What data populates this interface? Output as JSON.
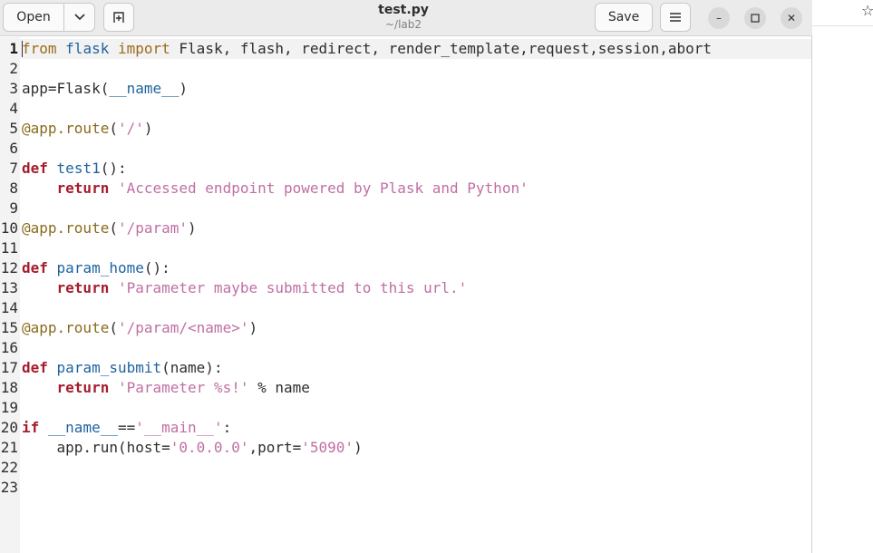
{
  "colors": {
    "keyword": "#a51d2d",
    "string": "#c06fa3",
    "function": "#1f63a0",
    "decorator": "#8a6a1a",
    "text": "#2e2e2e"
  },
  "toolbar": {
    "open_label": "Open",
    "open_arrow_icon": "chevron-down-icon",
    "new_tab_icon": "new-tab-icon",
    "save_label": "Save",
    "menu_icon": "hamburger-menu-icon"
  },
  "window": {
    "title": "test.py",
    "subtitle": "~/lab2",
    "minimize_glyph": "–",
    "maximize_glyph": "☐",
    "close_glyph": "✕"
  },
  "backdrop": {
    "star_glyph": "☆"
  },
  "editor": {
    "current_line": 1,
    "lines": [
      {
        "n": "1",
        "tokens": [
          {
            "t": "from",
            "c": "t-imp"
          },
          {
            "t": " ",
            "c": "t-plain"
          },
          {
            "t": "flask",
            "c": "t-mod"
          },
          {
            "t": " ",
            "c": "t-plain"
          },
          {
            "t": "import",
            "c": "t-imp"
          },
          {
            "t": " Flask, flash, redirect, render_template,request,session,abort",
            "c": "t-plain"
          }
        ]
      },
      {
        "n": "2",
        "tokens": []
      },
      {
        "n": "3",
        "tokens": [
          {
            "t": "app=Flask(",
            "c": "t-plain"
          },
          {
            "t": "__name__",
            "c": "t-dunder"
          },
          {
            "t": ")",
            "c": "t-plain"
          }
        ]
      },
      {
        "n": "4",
        "tokens": []
      },
      {
        "n": "5",
        "tokens": [
          {
            "t": "@app.route",
            "c": "t-deco"
          },
          {
            "t": "(",
            "c": "t-plain"
          },
          {
            "t": "'/'",
            "c": "t-str"
          },
          {
            "t": ")",
            "c": "t-plain"
          }
        ]
      },
      {
        "n": "6",
        "tokens": []
      },
      {
        "n": "7",
        "tokens": [
          {
            "t": "def",
            "c": "t-kw"
          },
          {
            "t": " ",
            "c": "t-plain"
          },
          {
            "t": "test1",
            "c": "t-fn"
          },
          {
            "t": "():",
            "c": "t-plain"
          }
        ]
      },
      {
        "n": "8",
        "tokens": [
          {
            "t": "    ",
            "c": "t-plain"
          },
          {
            "t": "return",
            "c": "t-kw"
          },
          {
            "t": " ",
            "c": "t-plain"
          },
          {
            "t": "'Accessed endpoint powered by Plask and Python'",
            "c": "t-str"
          }
        ]
      },
      {
        "n": "9",
        "tokens": []
      },
      {
        "n": "10",
        "tokens": [
          {
            "t": "@app.route",
            "c": "t-deco"
          },
          {
            "t": "(",
            "c": "t-plain"
          },
          {
            "t": "'/param'",
            "c": "t-str"
          },
          {
            "t": ")",
            "c": "t-plain"
          }
        ]
      },
      {
        "n": "11",
        "tokens": []
      },
      {
        "n": "12",
        "tokens": [
          {
            "t": "def",
            "c": "t-kw"
          },
          {
            "t": " ",
            "c": "t-plain"
          },
          {
            "t": "param_home",
            "c": "t-fn"
          },
          {
            "t": "():",
            "c": "t-plain"
          }
        ]
      },
      {
        "n": "13",
        "tokens": [
          {
            "t": "    ",
            "c": "t-plain"
          },
          {
            "t": "return",
            "c": "t-kw"
          },
          {
            "t": " ",
            "c": "t-plain"
          },
          {
            "t": "'Parameter maybe submitted to this url.'",
            "c": "t-str"
          }
        ]
      },
      {
        "n": "14",
        "tokens": []
      },
      {
        "n": "15",
        "tokens": [
          {
            "t": "@app.route",
            "c": "t-deco"
          },
          {
            "t": "(",
            "c": "t-plain"
          },
          {
            "t": "'/param/<name>'",
            "c": "t-str"
          },
          {
            "t": ")",
            "c": "t-plain"
          }
        ]
      },
      {
        "n": "16",
        "tokens": []
      },
      {
        "n": "17",
        "tokens": [
          {
            "t": "def",
            "c": "t-kw"
          },
          {
            "t": " ",
            "c": "t-plain"
          },
          {
            "t": "param_submit",
            "c": "t-fn"
          },
          {
            "t": "(name):",
            "c": "t-plain"
          }
        ]
      },
      {
        "n": "18",
        "tokens": [
          {
            "t": "    ",
            "c": "t-plain"
          },
          {
            "t": "return",
            "c": "t-kw"
          },
          {
            "t": " ",
            "c": "t-plain"
          },
          {
            "t": "'Parameter %s!'",
            "c": "t-str"
          },
          {
            "t": " % name",
            "c": "t-plain"
          }
        ]
      },
      {
        "n": "19",
        "tokens": []
      },
      {
        "n": "20",
        "tokens": [
          {
            "t": "if",
            "c": "t-kw"
          },
          {
            "t": " ",
            "c": "t-plain"
          },
          {
            "t": "__name__",
            "c": "t-dunder"
          },
          {
            "t": "==",
            "c": "t-plain"
          },
          {
            "t": "'__main__'",
            "c": "t-str"
          },
          {
            "t": ":",
            "c": "t-plain"
          }
        ]
      },
      {
        "n": "21",
        "tokens": [
          {
            "t": "    app.run(host=",
            "c": "t-plain"
          },
          {
            "t": "'0.0.0.0'",
            "c": "t-str"
          },
          {
            "t": ",port=",
            "c": "t-plain"
          },
          {
            "t": "'5090'",
            "c": "t-str"
          },
          {
            "t": ")",
            "c": "t-plain"
          }
        ]
      },
      {
        "n": "22",
        "tokens": []
      },
      {
        "n": "23",
        "tokens": []
      }
    ]
  }
}
